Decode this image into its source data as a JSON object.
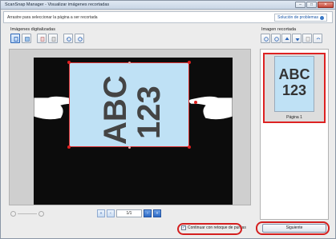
{
  "window": {
    "title": "ScanSnap Manager - Visualizar imágenes recortadas",
    "buttons": {
      "minimize": "–",
      "maximize": "□",
      "close": "✕"
    }
  },
  "infobar": {
    "instruction": "Arrastre para seleccionar la página a ser recortada",
    "troubleshoot": "Solución de problemas"
  },
  "left_panel": {
    "title": "Imágenes digitalizadas"
  },
  "right_panel": {
    "title": "Imagen recortada"
  },
  "document": {
    "line1": "ABC",
    "line2": "123"
  },
  "pager": {
    "first": "«",
    "prev": "‹",
    "page": "1/1",
    "next": "›",
    "last": "»"
  },
  "thumbnail": {
    "line1": "ABC",
    "line2": "123",
    "label": "Página 1"
  },
  "footer": {
    "checkbox_label": "Continuar con retoque de puntas",
    "checkbox_mark": "✓",
    "next_button": "Siguiente"
  },
  "colors": {
    "highlight": "#d41f1f",
    "document": "#bfe1f5",
    "scan_bg": "#0c0c0c"
  }
}
